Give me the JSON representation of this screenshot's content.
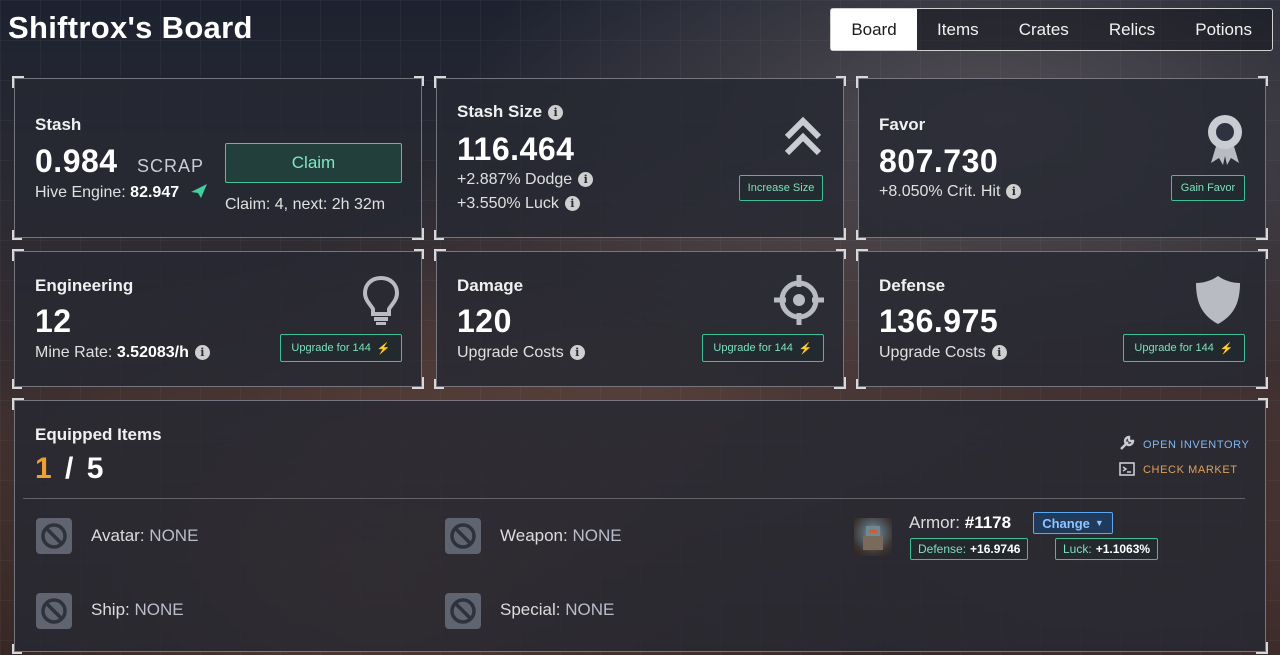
{
  "header": {
    "title": "Shiftrox's Board"
  },
  "tabs": [
    {
      "label": "Board",
      "active": true
    },
    {
      "label": "Items"
    },
    {
      "label": "Crates"
    },
    {
      "label": "Relics"
    },
    {
      "label": "Potions"
    }
  ],
  "stash": {
    "label": "Stash",
    "value": "0.984",
    "unit": "SCRAP",
    "hive_label": "Hive Engine:",
    "hive_value": "82.947",
    "claim_button": "Claim",
    "claim_info": "Claim: 4, next: 2h 32m"
  },
  "stash_size": {
    "label": "Stash Size",
    "value": "116.464",
    "dodge": "+2.887% Dodge",
    "luck": "+3.550% Luck",
    "button": "Increase Size"
  },
  "favor": {
    "label": "Favor",
    "value": "807.730",
    "crit": "+8.050% Crit. Hit",
    "button": "Gain Favor"
  },
  "engineering": {
    "label": "Engineering",
    "value": "12",
    "mine_label": "Mine Rate:",
    "mine_value": "3.52083/h",
    "button": "Upgrade for 144"
  },
  "damage": {
    "label": "Damage",
    "value": "120",
    "costs": "Upgrade Costs",
    "button": "Upgrade for 144"
  },
  "defense": {
    "label": "Defense",
    "value": "136.975",
    "costs": "Upgrade Costs",
    "button": "Upgrade for 144"
  },
  "equipped": {
    "label": "Equipped Items",
    "count": "1",
    "separator": "/",
    "total": "5",
    "open_inventory": "OPEN INVENTORY",
    "check_market": "CHECK MARKET",
    "slots": {
      "avatar_label": "Avatar:",
      "avatar_value": "NONE",
      "weapon_label": "Weapon:",
      "weapon_value": "NONE",
      "ship_label": "Ship:",
      "ship_value": "NONE",
      "special_label": "Special:",
      "special_value": "NONE"
    },
    "armor": {
      "label": "Armor:",
      "id": "#1178",
      "change": "Change",
      "defense_label": "Defense:",
      "defense_value": "+16.9746",
      "luck_label": "Luck:",
      "luck_value": "+1.1063%"
    }
  },
  "colors": {
    "accent_green": "#3fbf95",
    "accent_orange": "#f0a030",
    "accent_blue": "#5aa8f0"
  }
}
